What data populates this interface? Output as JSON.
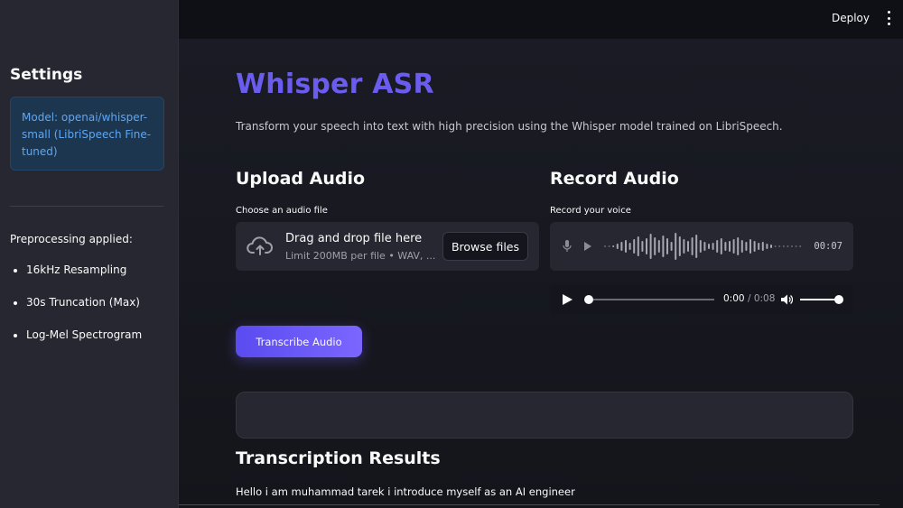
{
  "header": {
    "deploy_label": "Deploy",
    "menu_icon": "kebab-menu-icon"
  },
  "sidebar": {
    "title": "Settings",
    "info": "Model: openai/whisper-small (LibriSpeech Fine-tuned)",
    "preprocessing_label": "Preprocessing applied:",
    "items": [
      "16kHz Resampling",
      "30s Truncation (Max)",
      "Log-Mel Spectrogram"
    ]
  },
  "main": {
    "title": "Whisper ASR",
    "subtitle": "Transform your speech into text with high precision using the Whisper model trained on LibriSpeech.",
    "upload": {
      "heading": "Upload Audio",
      "label": "Choose an audio file",
      "drag_text": "Drag and drop file here",
      "limit_text": "Limit 200MB per file • WAV, ...",
      "browse_label": "Browse files"
    },
    "record": {
      "heading": "Record Audio",
      "label": "Record your voice",
      "timer": "00:07"
    },
    "player": {
      "current_time": "0:00",
      "separator": "/",
      "duration": "0:08",
      "progress": 0,
      "volume": 1
    },
    "transcribe_label": "Transcribe Audio",
    "results_heading": "Transcription Results",
    "results_text": "Hello i am muhammad tarek i introduce myself as an AI engineer"
  },
  "colors": {
    "accent": "#6b5cf0",
    "info_text": "#5fa6f2",
    "info_bg": "#1c3650"
  }
}
